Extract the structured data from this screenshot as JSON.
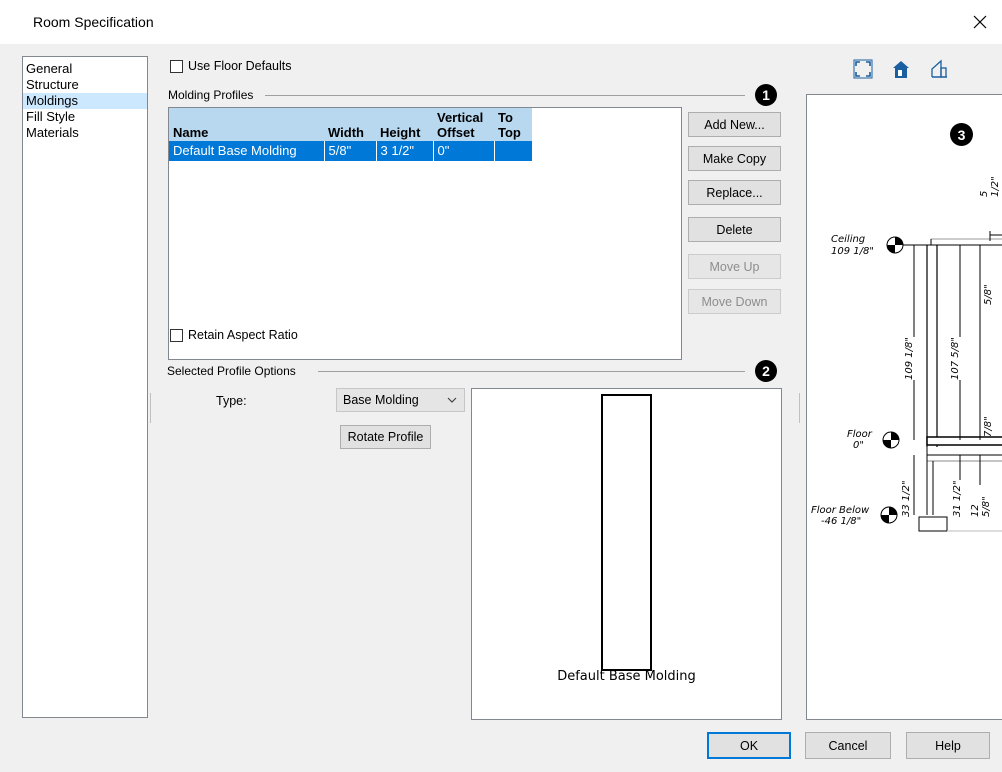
{
  "window": {
    "title": "Room Specification"
  },
  "nav": {
    "items": [
      {
        "label": "General"
      },
      {
        "label": "Structure"
      },
      {
        "label": "Moldings"
      },
      {
        "label": "Fill Style"
      },
      {
        "label": "Materials"
      }
    ],
    "selected": "Moldings"
  },
  "use_floor_defaults": {
    "label": "Use Floor Defaults",
    "checked": false
  },
  "molding_profiles": {
    "label": "Molding Profiles",
    "badge": "1",
    "columns": [
      "Name",
      "Width",
      "Height",
      "Vertical\nOffset",
      "To\nTop"
    ],
    "rows": [
      {
        "name": "Default Base Molding",
        "width": "5/8\"",
        "height": "3 1/2\"",
        "offset": "0\"",
        "totop": ""
      }
    ]
  },
  "buttons": {
    "add_new": "Add New...",
    "make_copy": "Make Copy",
    "replace": "Replace...",
    "delete": "Delete",
    "move_up": "Move Up",
    "move_down": "Move Down"
  },
  "retain_aspect": {
    "label": "Retain Aspect Ratio",
    "checked": false
  },
  "selected_profile": {
    "label": "Selected Profile Options",
    "badge": "2",
    "type_label": "Type:",
    "type_value": "Base Molding",
    "rotate_label": "Rotate Profile",
    "preview_caption": "Default Base Molding"
  },
  "section": {
    "badge": "3",
    "ceiling_label": "Ceiling",
    "ceiling_value": "109 1/8\"",
    "floor_label": "Floor",
    "floor_value": "0\"",
    "floor_below_label": "Floor Below",
    "floor_below_value": "-46 1/8\"",
    "dims": {
      "d1": "5 1/2\"",
      "d2": "5/8\"",
      "d3": "109 1/8\"",
      "d4": "107 5/8\"",
      "d5": "7/8\"",
      "d6": "33 1/2\"",
      "d7": "31 1/2\"",
      "d8": "12 5/8\""
    }
  },
  "footer": {
    "ok": "OK",
    "cancel": "Cancel",
    "help": "Help"
  },
  "icons": {
    "close": "close-icon",
    "fit": "fit-view-icon",
    "house": "house-icon",
    "elevation": "elevation-icon",
    "dropdown": "chevron-down-icon"
  },
  "colors": {
    "selection": "#0078d7",
    "header": "#b8d8f0",
    "nav_selected": "#cce8ff"
  }
}
